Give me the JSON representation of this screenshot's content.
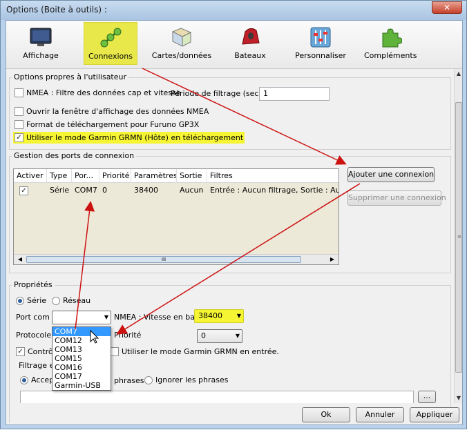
{
  "window": {
    "title": "Options (Boite à outils) :",
    "close_glyph": "✕"
  },
  "toolbar": [
    {
      "label": "Affichage",
      "icon": "monitor-icon"
    },
    {
      "label": "Connexions",
      "icon": "connections-icon",
      "selected": true
    },
    {
      "label": "Cartes/données",
      "icon": "charts-icon"
    },
    {
      "label": "Bateaux",
      "icon": "boat-icon"
    },
    {
      "label": "Personnaliser",
      "icon": "sliders-icon"
    },
    {
      "label": "Compléments",
      "icon": "puzzle-icon"
    }
  ],
  "user_options": {
    "title": "Options propres à l'utilisateur",
    "nmea_filter": {
      "label": "NMEA : Filtre des données cap et vitesse",
      "checked": false
    },
    "filter_period": {
      "label": "Période de filtrage (sec.)",
      "value": "1"
    },
    "open_nmea_window": {
      "label": "Ouvrir la fenêtre d'affichage des données NMEA",
      "checked": false
    },
    "furuno_format": {
      "label": "Format de téléchargement pour Furuno GP3X",
      "checked": false
    },
    "garmin_mode": {
      "label": "Utiliser le mode Garmin GRMN (Hôte) en téléchargement",
      "checked": true
    }
  },
  "ports": {
    "title": "Gestion des ports de connexion",
    "columns": [
      "Activer",
      "Type",
      "Por...",
      "Priorité",
      "Paramètres",
      "Sortie",
      "Filtres"
    ],
    "rows": [
      {
        "enabled": true,
        "type": "Série",
        "port": "COM7",
        "priority": "0",
        "params": "38400",
        "output": "Aucun",
        "filters": "Entrée : Aucun filtrage, Sortie : Aucun"
      }
    ],
    "add_button": "Ajouter une connexion",
    "remove_button": "Supprimer une connexion",
    "scroll_grip": "III"
  },
  "properties": {
    "title": "Propriétés",
    "serial": {
      "label": "Série",
      "selected": true
    },
    "network": {
      "label": "Réseau",
      "selected": false
    },
    "port_label": "Port com",
    "port_value": "",
    "baud_label": "NMEA : Vitesse en baud",
    "baud_value": "38400",
    "protocol_label": "Protocole",
    "priority_label": "Priorité",
    "priority_value": "0",
    "control_label": "Contrôl",
    "control_checked": true,
    "garmin_input_label": "Utiliser le mode Garmin GRMN en entrée.",
    "filter_label": "Filtrage en",
    "accept_label": "Accep",
    "phrases_label": "phrases",
    "ignore_label": "Ignorer les phrases",
    "more_button": "..."
  },
  "port_options": [
    "COM7",
    "COM12",
    "COM13",
    "COM15",
    "COM16",
    "COM17",
    "Garmin-USB"
  ],
  "footer": {
    "ok": "Ok",
    "cancel": "Annuler",
    "apply": "Appliquer"
  },
  "colors": {
    "highlight": "#f5f534",
    "arrow": "#cc1111",
    "selection": "#3399ff"
  }
}
